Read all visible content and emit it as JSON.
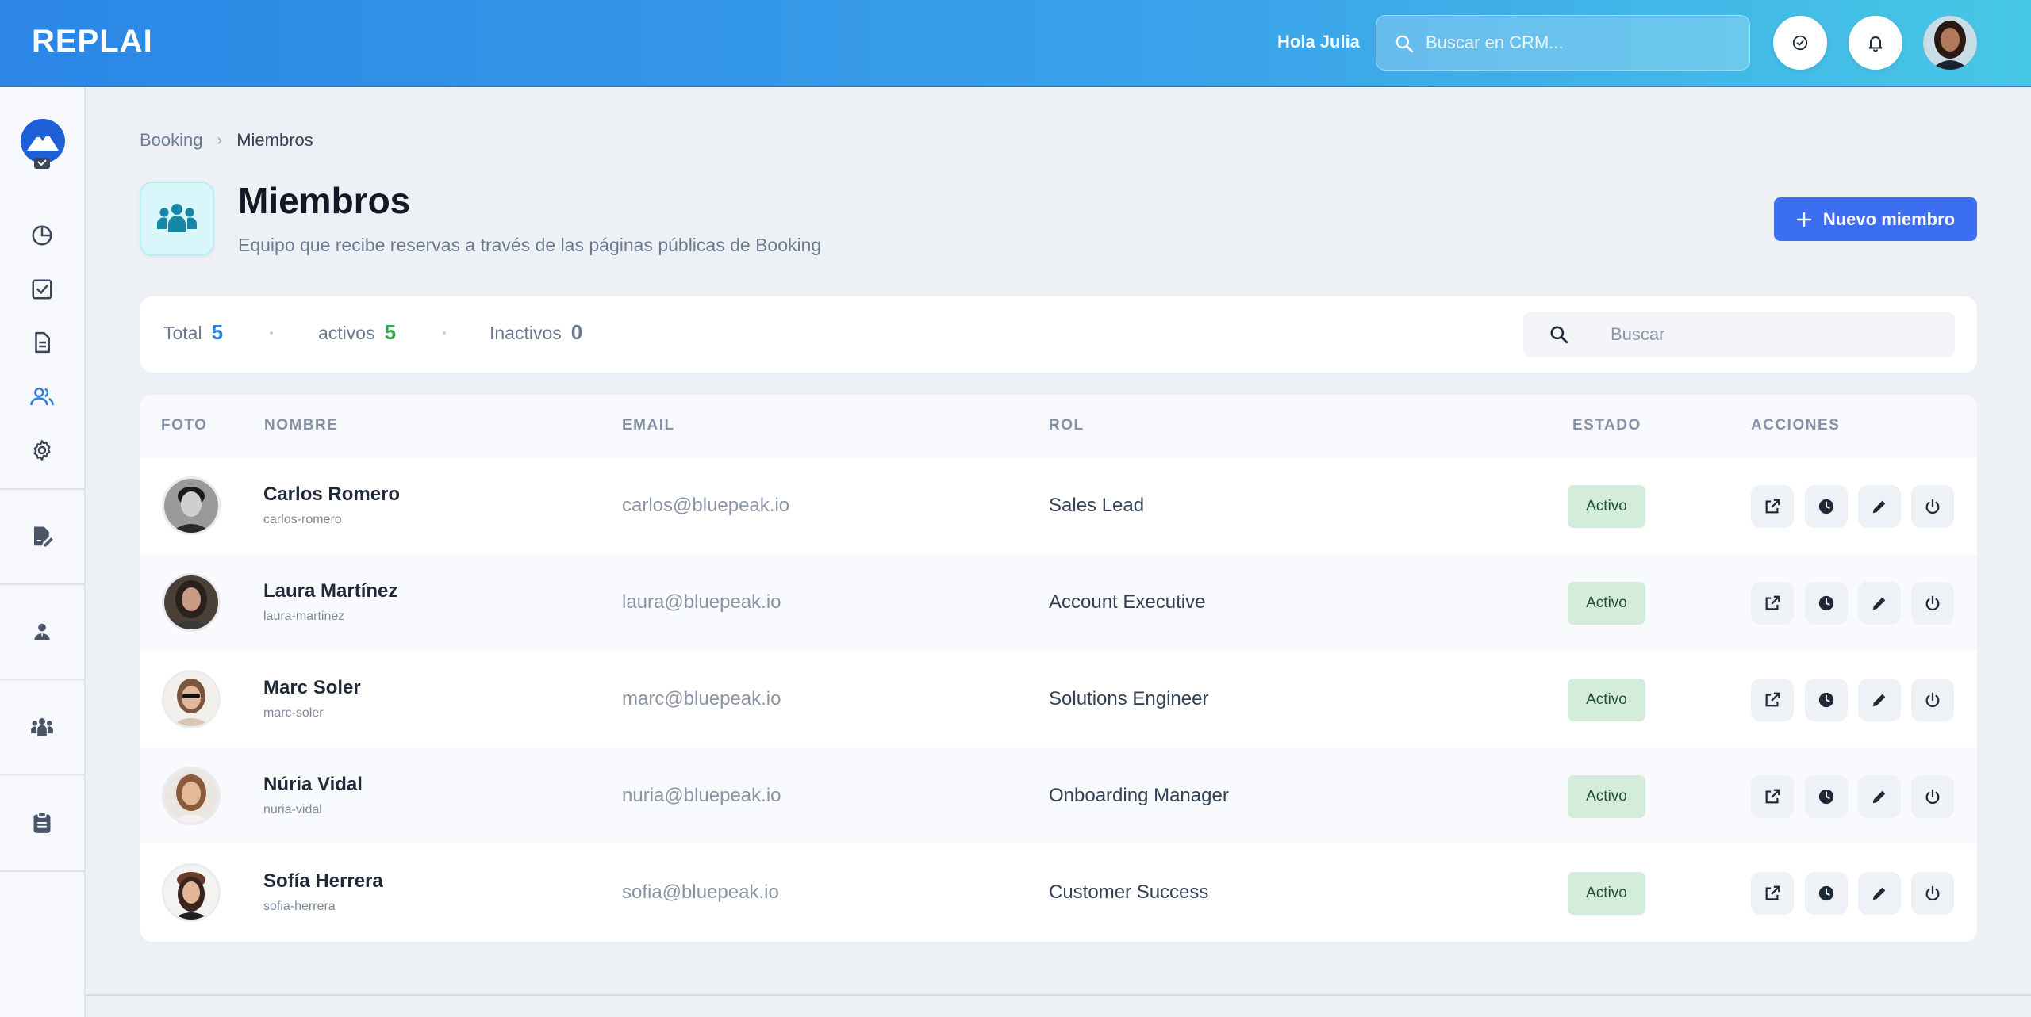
{
  "header": {
    "logo": "REPLAI",
    "greeting": "Hola Julia",
    "search_placeholder": "Buscar en CRM..."
  },
  "breadcrumb": {
    "parent": "Booking",
    "current": "Miembros"
  },
  "page": {
    "title": "Miembros",
    "subtitle": "Equipo que recibe reservas a través de las páginas públicas de Booking",
    "new_button": "Nuevo miembro"
  },
  "stats": {
    "total_label": "Total",
    "total_value": "5",
    "active_label": "activos",
    "active_value": "5",
    "inactive_label": "Inactivos",
    "inactive_value": "0",
    "search_placeholder": "Buscar"
  },
  "table": {
    "headers": {
      "foto": "FOTO",
      "nombre": "NOMBRE",
      "email": "EMAIL",
      "rol": "ROL",
      "estado": "ESTADO",
      "acciones": "ACCIONES"
    },
    "rows": [
      {
        "name": "Carlos Romero",
        "slug": "carlos-romero",
        "email": "carlos@bluepeak.io",
        "role": "Sales Lead",
        "status": "Activo"
      },
      {
        "name": "Laura Martínez",
        "slug": "laura-martinez",
        "email": "laura@bluepeak.io",
        "role": "Account Executive",
        "status": "Activo"
      },
      {
        "name": "Marc Soler",
        "slug": "marc-soler",
        "email": "marc@bluepeak.io",
        "role": "Solutions Engineer",
        "status": "Activo"
      },
      {
        "name": "Núria Vidal",
        "slug": "nuria-vidal",
        "email": "nuria@bluepeak.io",
        "role": "Onboarding Manager",
        "status": "Activo"
      },
      {
        "name": "Sofía Herrera",
        "slug": "sofia-herrera",
        "email": "sofia@bluepeak.io",
        "role": "Customer Success",
        "status": "Activo"
      }
    ]
  },
  "colors": {
    "header_gradient_start": "#2b86e6",
    "header_gradient_end": "#47c7e6",
    "primary": "#3b6ef0",
    "total_color": "#2f80d8",
    "active_color": "#2fa84f",
    "inactive_color": "#6b7a90",
    "badge_bg": "#d4edda",
    "badge_text": "#1f5130"
  },
  "icons": {
    "sidebar": [
      "mountain-logo-icon",
      "inbox-check-icon",
      "pie-chart-icon",
      "checkbox-icon",
      "document-icon",
      "users-icon",
      "gear-icon",
      "file-signature-icon",
      "user-tie-icon",
      "people-group-icon",
      "clipboard-icon"
    ],
    "row_actions": [
      "external-link-icon",
      "clock-icon",
      "pencil-icon",
      "power-icon"
    ]
  }
}
